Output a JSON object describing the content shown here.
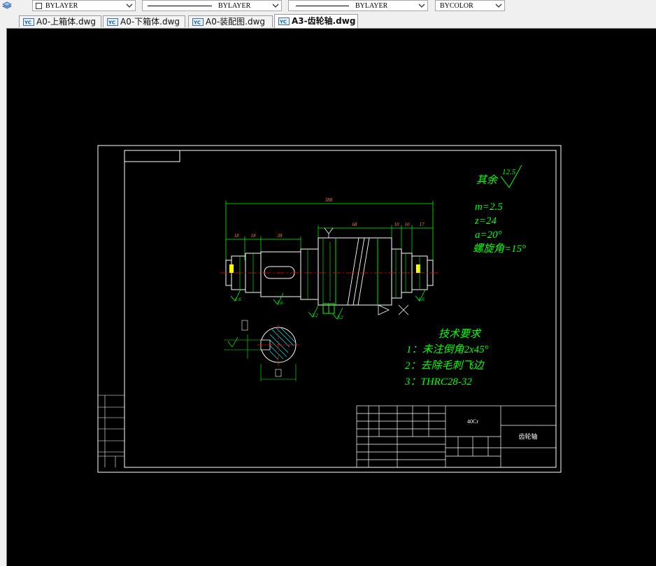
{
  "toolbar": {
    "color_combo": "BYLAYER",
    "linetype_combo": "BYLAYER",
    "lineweight_combo": "BYLAYER",
    "plotstyle_combo": "BYCOLOR"
  },
  "tabs": [
    {
      "label": "A0-上箱体.dwg",
      "active": false
    },
    {
      "label": "A0-下箱体.dwg",
      "active": false
    },
    {
      "label": "A0-装配图.dwg",
      "active": false
    },
    {
      "label": "A3-齿轮轴.dwg",
      "active": true
    }
  ],
  "drawing": {
    "roughness_prefix": "其余",
    "roughness_value": "12.5",
    "gear_params": [
      "m=2.5",
      "z=24",
      "a=20°",
      "螺旋角=15°"
    ],
    "tech_title": "技术要求",
    "tech_items": [
      "1：未注倒角2x45°",
      "2：去除毛刺飞边",
      "3：THRC28-32"
    ],
    "dims": {
      "overall": "388",
      "d1": "18",
      "d2": "18",
      "d3": "38",
      "d4": "68",
      "d5": "10",
      "d6": "10",
      "d7": "17"
    },
    "roughness_marks": [
      "1.6",
      "1.6",
      "3.2",
      "3.2",
      "1.6"
    ],
    "title_block": {
      "material": "40Cr",
      "part_name": "齿轮轴"
    }
  },
  "colors": {
    "canvas_bg": "#000000",
    "cad_green": "#00ff00",
    "cad_white": "#ffffff",
    "cad_red": "#ff0000",
    "cad_yellow": "#ffff00",
    "cad_cyan": "#00ffff"
  }
}
